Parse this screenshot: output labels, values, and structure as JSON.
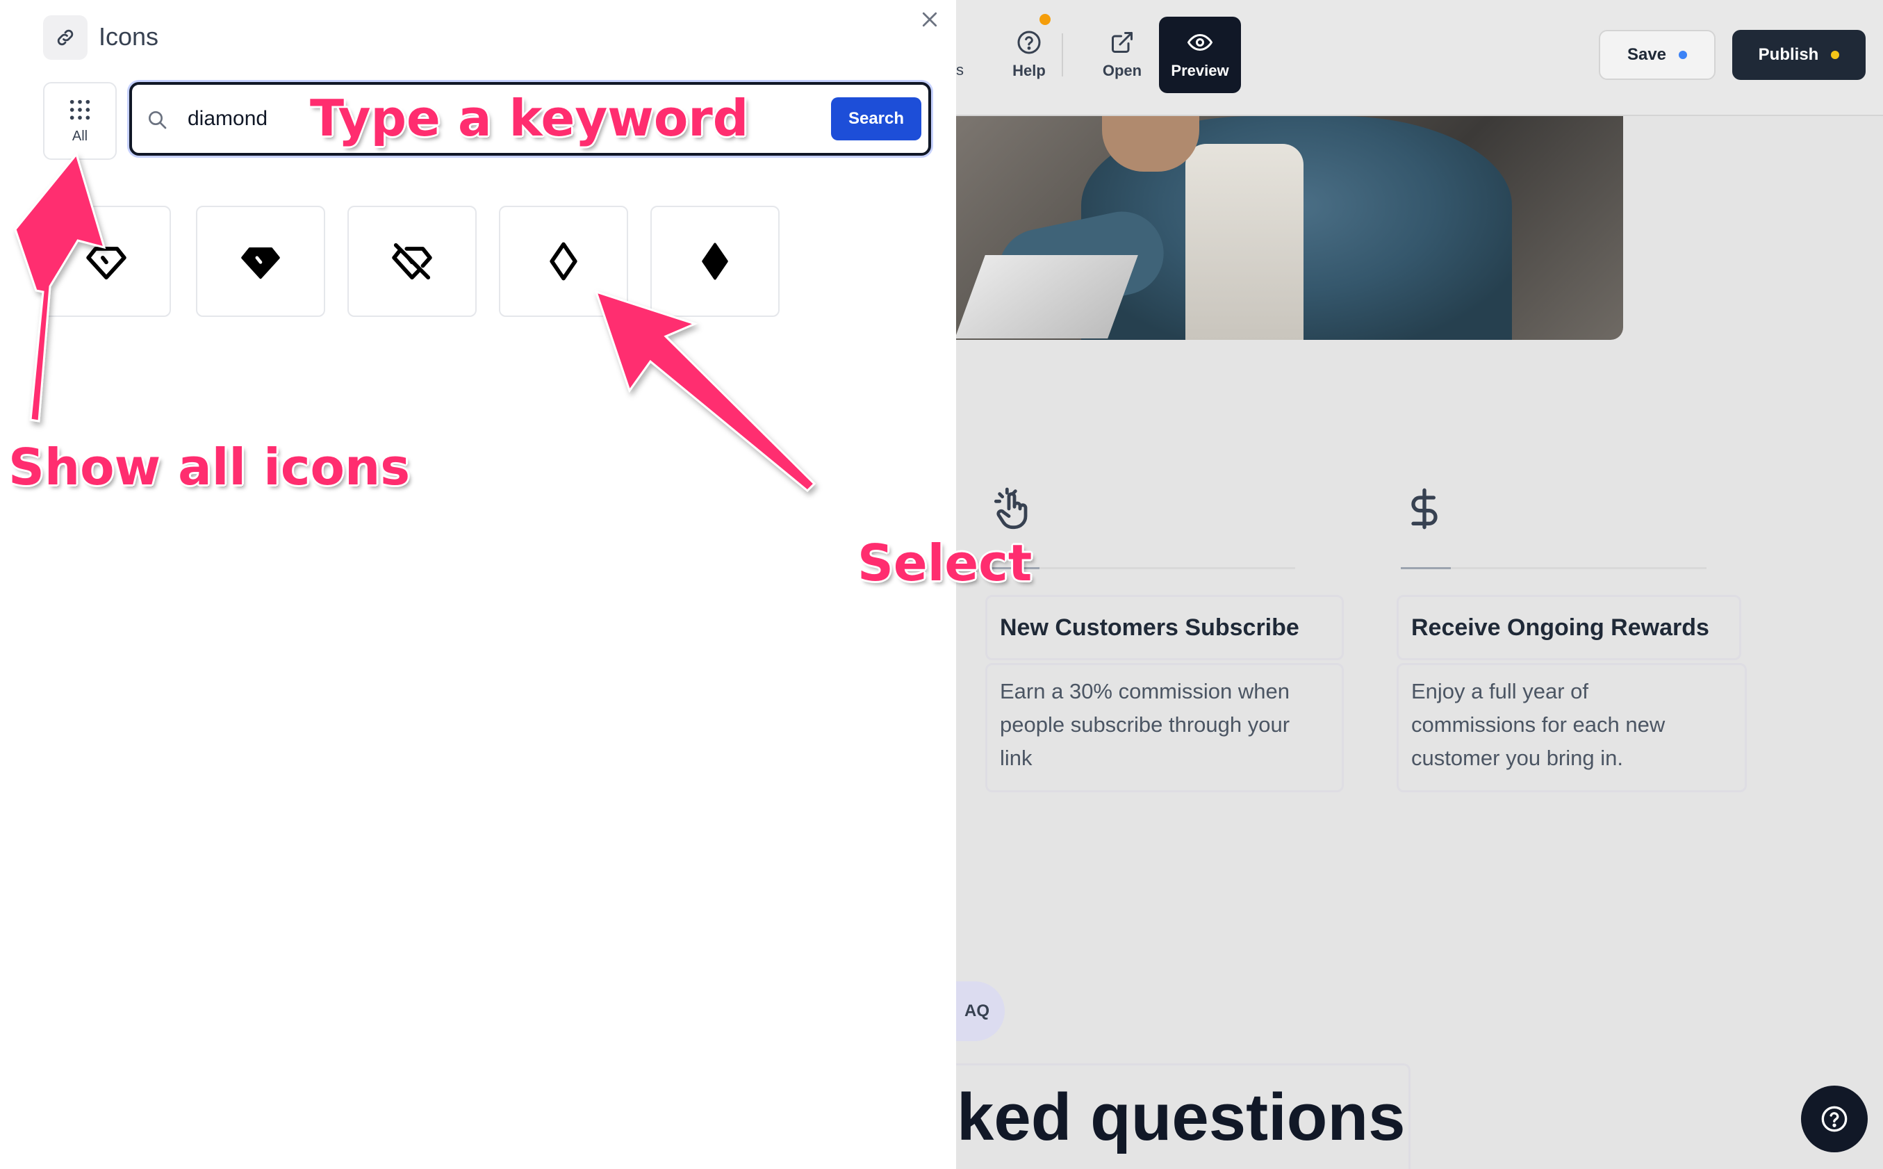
{
  "builder": {
    "toolbar": {
      "clipped_label": "s",
      "help_label": "Help",
      "open_label": "Open",
      "preview_label": "Preview",
      "save_label": "Save",
      "publish_label": "Publish",
      "save_dot_color": "#3b82f6",
      "publish_dot_color": "#f5c518",
      "notification_dot_color": "#f59e0b"
    },
    "features": [
      {
        "icon": "hand-pointer-icon",
        "title": "New Customers Subscribe",
        "desc_lines": [
          "Earn a 30% commission when",
          "people subscribe through your",
          "link"
        ]
      },
      {
        "icon": "dollar-sign-icon",
        "title": "Receive Ongoing Rewards",
        "desc_lines": [
          "Enjoy a full year of",
          "commissions for each new",
          "customer you bring in."
        ]
      }
    ],
    "faq_pill": "AQ",
    "faq_heading": "ked questions"
  },
  "panel": {
    "title": "Icons",
    "title_icon": "link-icon",
    "all_label": "All",
    "search": {
      "value": "diamond",
      "button_label": "Search"
    },
    "results": [
      {
        "icon": "diamond-outline-icon"
      },
      {
        "icon": "diamond-filled-icon"
      },
      {
        "icon": "diamond-off-icon"
      },
      {
        "icon": "rhombus-outline-icon"
      },
      {
        "icon": "rhombus-filled-icon"
      }
    ]
  },
  "annotations": {
    "keyword": "Type a keyword",
    "show_all": "Show all icons",
    "select": "Select",
    "color": "#ff2d6f"
  }
}
